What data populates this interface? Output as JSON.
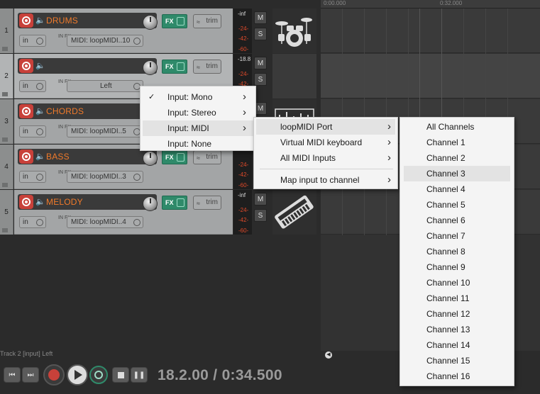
{
  "tracks": [
    {
      "num": "1",
      "name": "DRUMS",
      "input": "in",
      "source": "MIDI: loopMIDI..10",
      "meter_top": "-inf",
      "meter_vals": [
        "-24-",
        "-42-",
        "-60-"
      ],
      "mute": "M",
      "solo": "S",
      "thumb": "drum-kit-icon",
      "fx": "FX",
      "trim": "trim",
      "in_fx": "IN FX"
    },
    {
      "num": "2",
      "name": "",
      "input": "in",
      "source": "Left",
      "meter_top": "-18.8",
      "meter_vals": [
        "-24-",
        "-42-"
      ],
      "mute": "M",
      "solo": "S",
      "thumb": "",
      "fx": "FX",
      "trim": "trim",
      "in_fx": "IN FX"
    },
    {
      "num": "3",
      "name": "CHORDS",
      "input": "in",
      "source": "MIDI: loopMIDI..5",
      "meter_top": "",
      "meter_vals": [],
      "mute": "M",
      "solo": "",
      "thumb": "chords-icon",
      "fx": "",
      "trim": "",
      "in_fx": "IN FX"
    },
    {
      "num": "4",
      "name": "BASS",
      "input": "in",
      "source": "MIDI: loopMIDI..3",
      "meter_top": "",
      "meter_vals": [
        "-24-",
        "-42-",
        "-60-"
      ],
      "mute": "",
      "solo": "",
      "thumb": "",
      "fx": "FX",
      "trim": "trim",
      "in_fx": "IN FX"
    },
    {
      "num": "5",
      "name": "MELODY",
      "input": "in",
      "source": "MIDI: loopMIDI..4",
      "meter_top": "-inf",
      "meter_vals": [
        "-24-",
        "-42-",
        "-60-"
      ],
      "mute": "M",
      "solo": "S",
      "thumb": "keyboard-icon",
      "fx": "FX",
      "trim": "trim",
      "in_fx": "IN FX"
    }
  ],
  "ruler": {
    "mark1": "0:00.000",
    "mark2": "0:32.000"
  },
  "input_menu": {
    "items": [
      {
        "label": "Input: Mono",
        "checked": true,
        "submenu": true
      },
      {
        "label": "Input: Stereo",
        "checked": false,
        "submenu": true
      },
      {
        "label": "Input: MIDI",
        "checked": false,
        "submenu": true,
        "highlighted": true
      },
      {
        "label": "Input: None",
        "checked": false,
        "submenu": false
      }
    ]
  },
  "midi_menu": {
    "items": [
      {
        "label": "loopMIDI Port",
        "submenu": true,
        "highlighted": true
      },
      {
        "label": "Virtual MIDI keyboard",
        "submenu": true
      },
      {
        "label": "All MIDI Inputs",
        "submenu": true
      },
      {
        "label": "Map input to channel",
        "submenu": true
      }
    ]
  },
  "channel_menu": {
    "items": [
      "All Channels",
      "Channel 1",
      "Channel 2",
      "Channel 3",
      "Channel 4",
      "Channel 5",
      "Channel 6",
      "Channel 7",
      "Channel 8",
      "Channel 9",
      "Channel 10",
      "Channel 11",
      "Channel 12",
      "Channel 13",
      "Channel 14",
      "Channel 15",
      "Channel 16"
    ],
    "highlighted_index": 3
  },
  "status_text": "Track 2 [input] Left",
  "transport": {
    "time": "18.2.00 / 0:34.500",
    "buttons": [
      "go-to-start-icon",
      "go-to-end-icon",
      "record-icon",
      "play-icon",
      "loop-icon",
      "stop-icon",
      "pause-icon"
    ]
  },
  "colors": {
    "track_name": "#f07a2a",
    "record": "#c8413a",
    "fx": "#2f8a6a",
    "meter": "#e04a2a"
  }
}
